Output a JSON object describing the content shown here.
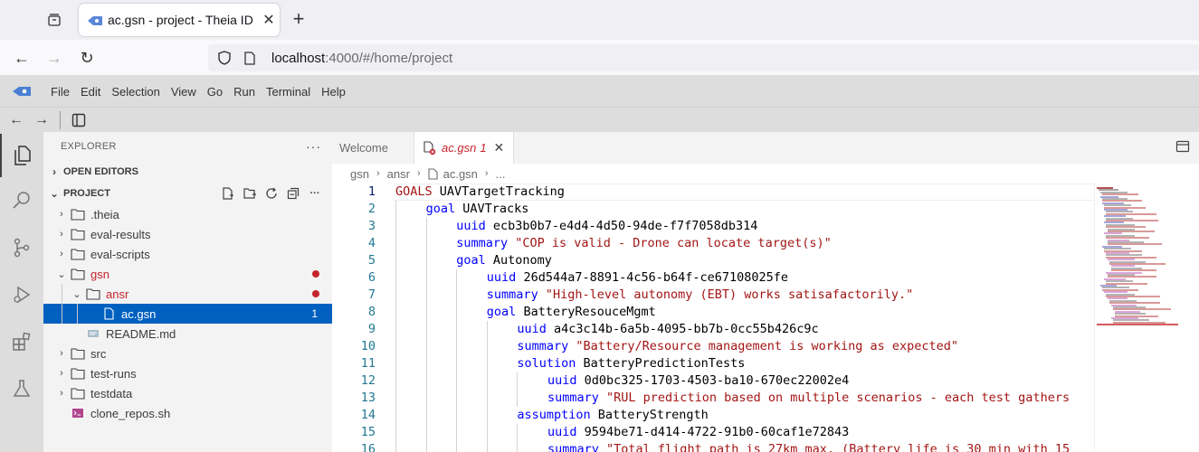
{
  "browser": {
    "tab_title": "ac.gsn - project - Theia ID",
    "url_host": "localhost",
    "url_rest": ":4000/#/home/project"
  },
  "menu": [
    "File",
    "Edit",
    "Selection",
    "View",
    "Go",
    "Run",
    "Terminal",
    "Help"
  ],
  "explorer": {
    "title": "EXPLORER",
    "open_editors": "OPEN EDITORS",
    "project": "PROJECT",
    "items": [
      {
        "label": ".theia",
        "type": "folder",
        "depth": 1,
        "expanded": false
      },
      {
        "label": "eval-results",
        "type": "folder",
        "depth": 1,
        "expanded": false
      },
      {
        "label": "eval-scripts",
        "type": "folder",
        "depth": 1,
        "expanded": false
      },
      {
        "label": "gsn",
        "type": "folder",
        "depth": 1,
        "expanded": true,
        "modified": true
      },
      {
        "label": "ansr",
        "type": "folder",
        "depth": 2,
        "expanded": true,
        "modified": true
      },
      {
        "label": "ac.gsn",
        "type": "file",
        "depth": 3,
        "selected": true,
        "count": "1"
      },
      {
        "label": "README.md",
        "type": "md",
        "depth": 2
      },
      {
        "label": "src",
        "type": "folder",
        "depth": 1,
        "expanded": false
      },
      {
        "label": "test-runs",
        "type": "folder",
        "depth": 1,
        "expanded": false
      },
      {
        "label": "testdata",
        "type": "folder",
        "depth": 1,
        "expanded": false
      },
      {
        "label": "clone_repos.sh",
        "type": "sh",
        "depth": 1
      }
    ]
  },
  "editor": {
    "tabs": [
      {
        "label": "Welcome",
        "active": false
      },
      {
        "label": "ac.gsn",
        "badge": "1",
        "active": true
      }
    ],
    "breadcrumbs": [
      "gsn",
      "ansr",
      "ac.gsn",
      "..."
    ],
    "lines": [
      {
        "n": "1",
        "indent": 0,
        "kw": "GOALS",
        "rest": " UAVTargetTracking",
        "kind": "ident"
      },
      {
        "n": "2",
        "indent": 1,
        "kw": "goal",
        "rest": " UAVTracks",
        "kind": "ident"
      },
      {
        "n": "3",
        "indent": 2,
        "kw": "uuid",
        "rest": " ecb3b0b7-e4d4-4d50-94de-f7f7058db314",
        "kind": "ident"
      },
      {
        "n": "4",
        "indent": 2,
        "kw": "summary",
        "rest": " \"COP is valid - Drone can locate target(s)\"",
        "kind": "str"
      },
      {
        "n": "5",
        "indent": 2,
        "kw": "goal",
        "rest": " Autonomy",
        "kind": "ident"
      },
      {
        "n": "6",
        "indent": 3,
        "kw": "uuid",
        "rest": " 26d544a7-8891-4c56-b64f-ce67108025fe",
        "kind": "ident"
      },
      {
        "n": "7",
        "indent": 3,
        "kw": "summary",
        "rest": " \"High-level autonomy (EBT) works satisafactorily.\"",
        "kind": "str"
      },
      {
        "n": "8",
        "indent": 3,
        "kw": "goal",
        "rest": " BatteryResouceMgmt",
        "kind": "ident"
      },
      {
        "n": "9",
        "indent": 4,
        "kw": "uuid",
        "rest": " a4c3c14b-6a5b-4095-bb7b-0cc55b426c9c",
        "kind": "ident"
      },
      {
        "n": "10",
        "indent": 4,
        "kw": "summary",
        "rest": " \"Battery/Resource management is working as expected\"",
        "kind": "str"
      },
      {
        "n": "11",
        "indent": 4,
        "kw": "solution",
        "rest": " BatteryPredictionTests",
        "kind": "ident"
      },
      {
        "n": "12",
        "indent": 5,
        "kw": "uuid",
        "rest": " 0d0bc325-1703-4503-ba10-670ec22002e4",
        "kind": "ident"
      },
      {
        "n": "13",
        "indent": 5,
        "kw": "summary",
        "rest": " \"RUL prediction based on multiple scenarios - each test gathers",
        "kind": "str"
      },
      {
        "n": "14",
        "indent": 4,
        "kw": "assumption",
        "rest": " BatteryStrength",
        "kind": "ident"
      },
      {
        "n": "15",
        "indent": 5,
        "kw": "uuid",
        "rest": " 9594be71-d414-4722-91b0-60caf1e72843",
        "kind": "ident"
      },
      {
        "n": "16",
        "indent": 5,
        "kw": "summary",
        "rest": " \"Total flight path is 27km max. (Battery life is 30 min with 15",
        "kind": "str"
      }
    ]
  },
  "colors": {
    "accent": "#0060c0",
    "modified": "#c6242c",
    "keyword": "#0000ff",
    "string": "#a31515"
  }
}
